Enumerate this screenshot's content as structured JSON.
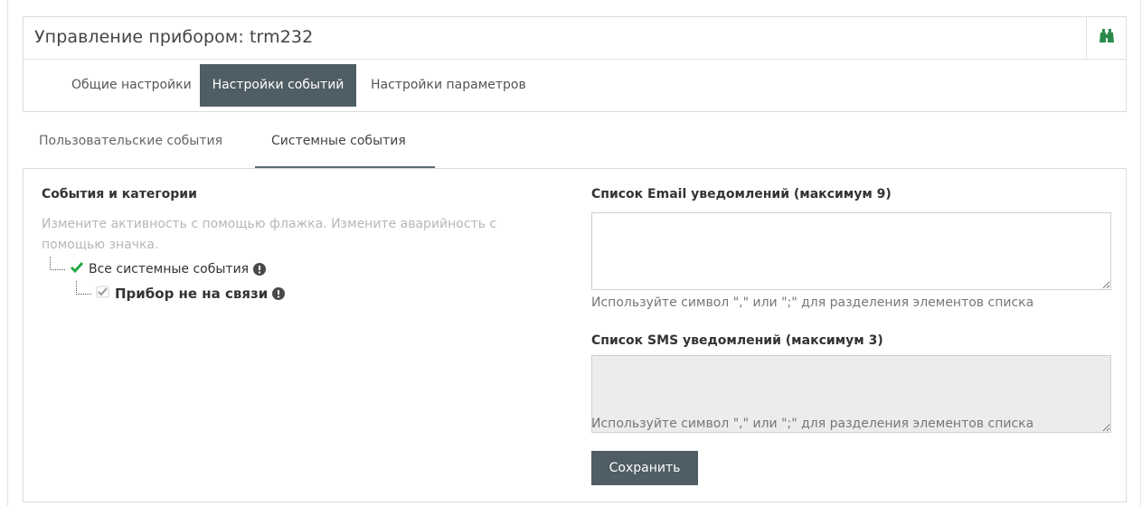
{
  "header": {
    "title": "Управление прибором: trm232",
    "search_icon": "binoculars-icon"
  },
  "main_tabs": [
    {
      "label": "Общие настройки",
      "active": false
    },
    {
      "label": "Настройки событий",
      "active": true
    },
    {
      "label": "Настройки параметров",
      "active": false
    }
  ],
  "sub_tabs": [
    {
      "label": "Пользовательские события",
      "active": false
    },
    {
      "label": "Системные события",
      "active": true
    }
  ],
  "events": {
    "title": "События и категории",
    "hint": "Измените активность с помощью флажка. Измените аварийность с помощью значка.",
    "tree": [
      {
        "label": "Все системные события",
        "checked": true,
        "icon": "exclamation-circle-icon"
      },
      {
        "label": "Прибор не на связи",
        "checked": true,
        "icon": "exclamation-circle-icon"
      }
    ]
  },
  "email": {
    "title": "Список Email уведомлений (максимум 9)",
    "value": "",
    "note": "Используйте символ \",\" или \";\" для разделения элементов списка"
  },
  "sms": {
    "title": "Список SMS уведомлений (максимум 3)",
    "value": "",
    "disabled": true,
    "note": "Используйте символ \",\" или \";\" для разделения элементов списка"
  },
  "actions": {
    "save_label": "Сохранить"
  },
  "colors": {
    "accent": "#4f5d64",
    "check_green": "#27a844"
  }
}
